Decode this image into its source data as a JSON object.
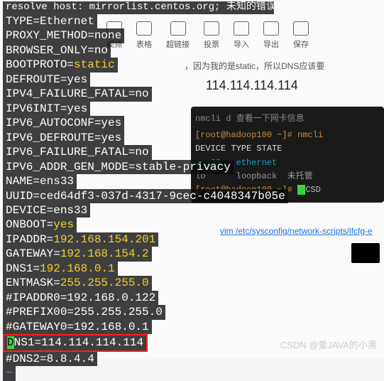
{
  "background": {
    "faded_top": "resolve host: mirrorlist.centos.org; 未知的错误",
    "toolbar": [
      {
        "label": "视频"
      },
      {
        "label": "表格"
      },
      {
        "label": "超链接"
      },
      {
        "label": "投票"
      },
      {
        "label": "导入"
      },
      {
        "label": "导出"
      },
      {
        "label": "保存"
      }
    ],
    "desc": "，因为我的是static，所以DNS应该要",
    "ip_text": "114.114.114.114",
    "secondary": {
      "title": "nmcli d 查看一下网卡信息",
      "prompt1": "[root@hadoop100 ~]# nmcli",
      "header": "DEVICE  TYPE      STATE",
      "row1a": "ens33",
      "row1b": "ethernet",
      "row2a": "lo",
      "row2b": "loopback",
      "row2c": "未托管",
      "prompt2": "[root@hadoop100 ~]# ",
      "csd": "CSD"
    },
    "vim_path": "vim /etc/sysconfig/network-scripts/ifcfg-e"
  },
  "config": {
    "lines": [
      "TYPE=Ethernet",
      "PROXY_METHOD=none",
      "BROWSER_ONLY=no",
      "BOOTPROTO=static",
      "DEFROUTE=yes",
      "IPV4_FAILURE_FATAL=no",
      "IPV6INIT=yes",
      "IPV6_AUTOCONF=yes",
      "IPV6_DEFROUTE=yes",
      "IPV6_FAILURE_FATAL=no",
      "IPV6_ADDR_GEN_MODE=stable-privacy",
      "NAME=ens33",
      "UUID=ced64df3-037d-4317-9cec-c4048347b05e",
      "DEVICE=ens33",
      "ONBOOT=yes",
      "IPADDR=192.168.154.201",
      "GATEWAY=192.168.154.2",
      "DNS1=192.168.0.1",
      "ENTMASK=255.255.255.0",
      "#IPADDR0=192.168.0.122",
      "#PREFIX00=255.255.255.0",
      "#GATEWAY0=192.168.0.1"
    ],
    "highlight_first": "D",
    "highlight_rest": "NS1=114.114.114.114",
    "last_line": "#DNS2=8.8.4.4",
    "tilde": "~"
  },
  "watermark": "CSDN @爱JAVA的小黑"
}
